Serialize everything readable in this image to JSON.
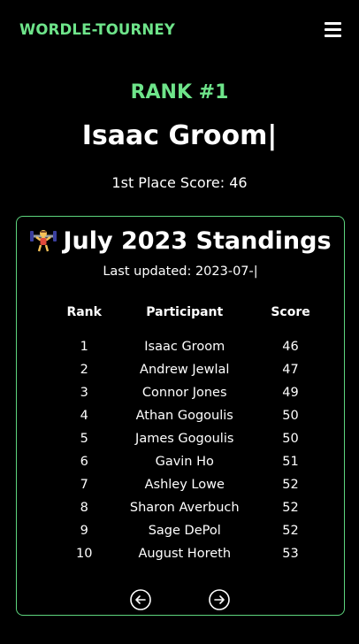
{
  "header": {
    "brand": "WORDLE-TOURNEY",
    "menu_icon": "hamburger-menu-icon"
  },
  "hero": {
    "rank": "RANK #1",
    "name": "Isaac Groom|",
    "score_text": "1st Place Score: 46"
  },
  "standings": {
    "icon": "weightlifter-icon",
    "title": "July 2023 Standings",
    "last_updated": "Last updated: 2023-07-|",
    "columns": [
      "Rank",
      "Participant",
      "Score"
    ],
    "rows": [
      {
        "rank": "1",
        "participant": "Isaac Groom",
        "score": "46"
      },
      {
        "rank": "2",
        "participant": "Andrew Jewlal",
        "score": "47"
      },
      {
        "rank": "3",
        "participant": "Connor Jones",
        "score": "49"
      },
      {
        "rank": "4",
        "participant": "Athan Gogoulis",
        "score": "50"
      },
      {
        "rank": "5",
        "participant": "James Gogoulis",
        "score": "50"
      },
      {
        "rank": "6",
        "participant": "Gavin Ho",
        "score": "51"
      },
      {
        "rank": "7",
        "participant": "Ashley Lowe",
        "score": "52"
      },
      {
        "rank": "8",
        "participant": "Sharon Averbuch",
        "score": "52"
      },
      {
        "rank": "9",
        "participant": "Sage DePol",
        "score": "52"
      },
      {
        "rank": "10",
        "participant": "August Horeth",
        "score": "53"
      }
    ],
    "prev_icon": "arrow-left-circle-icon",
    "next_icon": "arrow-right-circle-icon"
  },
  "colors": {
    "background": "#000000",
    "accent_green": "#6ee48a",
    "card_border": "#5dd57e",
    "text": "#ffffff"
  }
}
